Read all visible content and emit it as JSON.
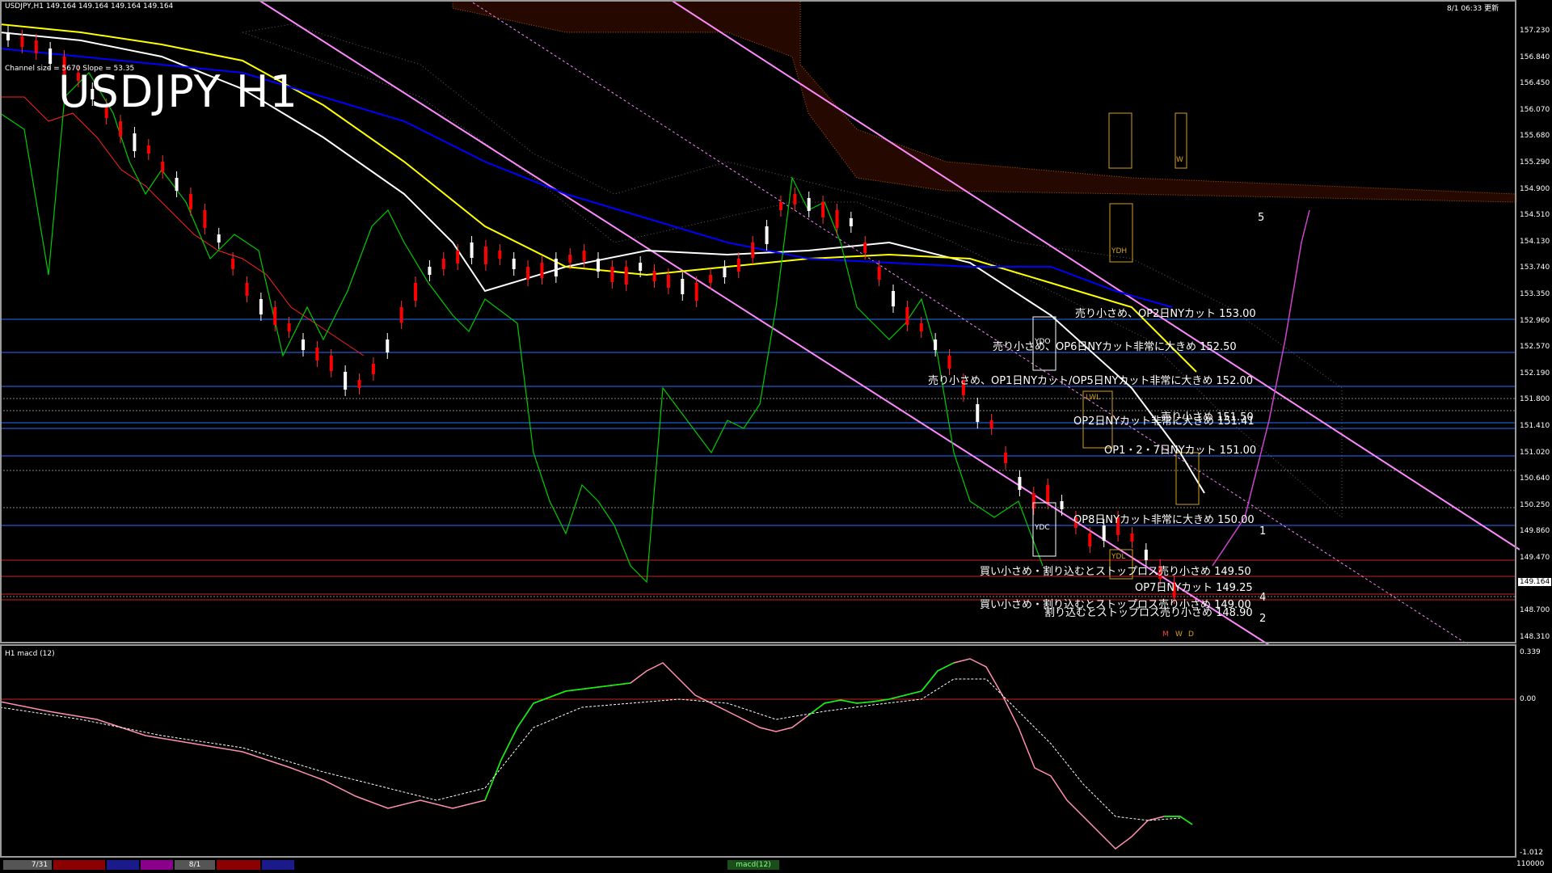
{
  "header": {
    "symbol_info": "USDJPY,H1  149.164 149.164 149.164 149.164",
    "channel_info": "Channel size = 5670  Slope = 53.35",
    "big_title": "USDJPY H1",
    "server_time": "8/1 06:33 更新"
  },
  "price_axis": {
    "labels": [
      "157.230",
      "156.840",
      "156.450",
      "156.070",
      "155.680",
      "155.290",
      "154.900",
      "154.510",
      "154.130",
      "153.740",
      "153.350",
      "152.960",
      "152.570",
      "152.190",
      "151.800",
      "151.410",
      "151.020",
      "150.640",
      "150.250",
      "149.860",
      "149.470",
      "149.080",
      "148.700",
      "148.310"
    ],
    "current_price": "149.164"
  },
  "macd_axis": {
    "labels": [
      "0.339",
      "0.00",
      "-1.012"
    ]
  },
  "sub_window": {
    "title": "H1  macd (12)"
  },
  "annotations": [
    {
      "text": "売り小さめ、OP2日NYカット 153.00"
    },
    {
      "text": "売り小さめ、OP6日NYカット非常に大きめ 152.50"
    },
    {
      "text": "売り小さめ、OP1日NYカット/OP5日NYカット非常に大きめ 152.00"
    },
    {
      "text": "売り小さめ 151.50"
    },
    {
      "text": "OP2日NYカット非常に大きめ 151.41"
    },
    {
      "text": "OP1・2・7日NYカット 151.00"
    },
    {
      "text": "OP8日NYカット非常に大きめ 150.00"
    },
    {
      "text": "買い小さめ・割り込むとストップロス売り小さめ 149.50"
    },
    {
      "text": "OP7日NYカット 149.25"
    },
    {
      "text": "買い小さめ・割り込むとストップロス売り小さめ 149.00"
    },
    {
      "text": "割り込むとストップロス売り小さめ 148.90"
    }
  ],
  "box_labels": {
    "ydo": "YDO",
    "ydc": "YDC",
    "ydh": "YDH",
    "ydl": "YDL",
    "lwl": "LWL",
    "w": "W",
    "m": "M",
    "d": "D"
  },
  "wave_labels": [
    "5",
    "1",
    "4",
    "2"
  ],
  "time_axis": {
    "d1": "7/31",
    "d2": "8/1",
    "indicator_tab": "macd(12)",
    "right_label": "110000"
  },
  "colors": {
    "bull": "#ffffff",
    "bear": "#ff0000",
    "ma_fast": "#ffffff",
    "ma_mid": "#ffff00",
    "ma_slow": "#0000ff",
    "lagging": "#00cc00",
    "channel": "#ff88ff",
    "macd_main": "#ff8fb0",
    "macd_up": "#00ff00",
    "signal": "#ffffff",
    "kumo": "#cc5500",
    "hline": "#2a6cff"
  }
}
